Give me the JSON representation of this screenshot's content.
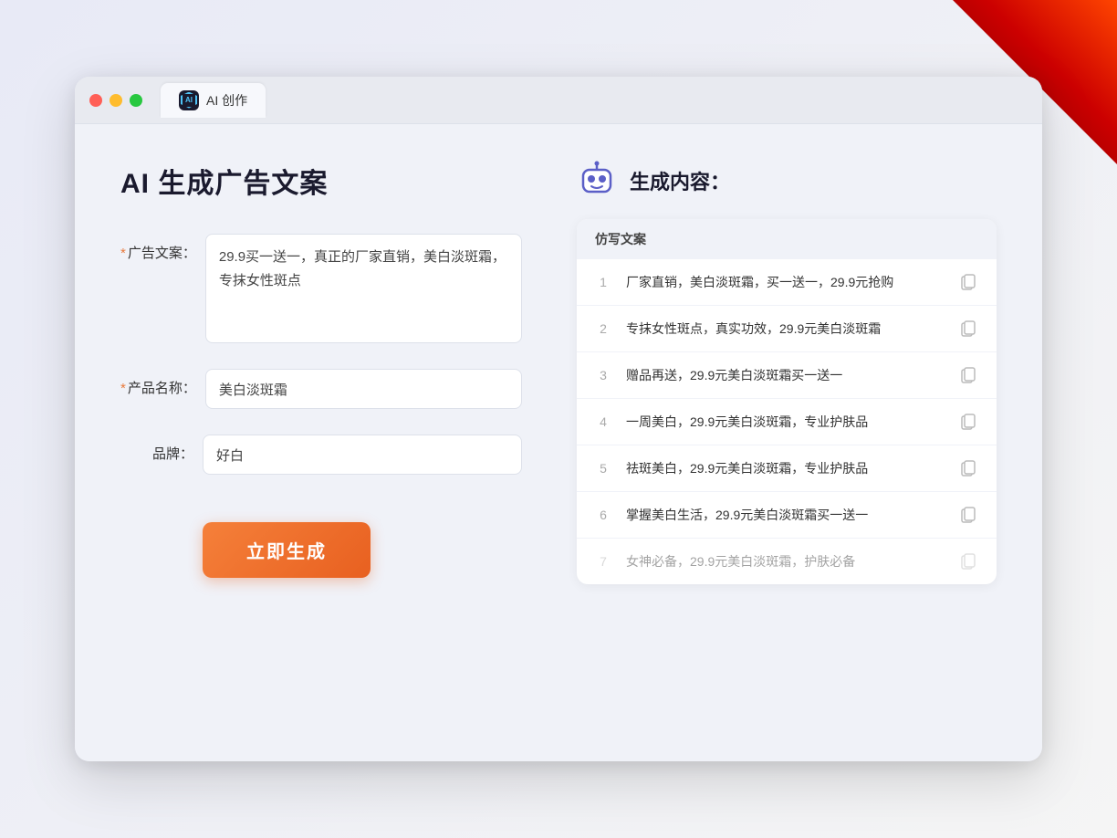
{
  "window": {
    "tab_label": "AI 创作",
    "controls": {
      "close": "close",
      "minimize": "minimize",
      "maximize": "maximize"
    }
  },
  "left_panel": {
    "title": "AI 生成广告文案",
    "form": {
      "ad_copy_label": "广告文案：",
      "ad_copy_required": "*",
      "ad_copy_value": "29.9买一送一，真正的厂家直销，美白淡斑霜，专抹女性斑点",
      "product_name_label": "产品名称：",
      "product_name_required": "*",
      "product_name_value": "美白淡斑霜",
      "brand_label": "品牌：",
      "brand_value": "好白"
    },
    "generate_button": "立即生成"
  },
  "right_panel": {
    "header_title": "生成内容：",
    "table_header": "仿写文案",
    "results": [
      {
        "num": "1",
        "text": "厂家直销，美白淡斑霜，买一送一，29.9元抢购",
        "muted": false
      },
      {
        "num": "2",
        "text": "专抹女性斑点，真实功效，29.9元美白淡斑霜",
        "muted": false
      },
      {
        "num": "3",
        "text": "赠品再送，29.9元美白淡斑霜买一送一",
        "muted": false
      },
      {
        "num": "4",
        "text": "一周美白，29.9元美白淡斑霜，专业护肤品",
        "muted": false
      },
      {
        "num": "5",
        "text": "祛斑美白，29.9元美白淡斑霜，专业护肤品",
        "muted": false
      },
      {
        "num": "6",
        "text": "掌握美白生活，29.9元美白淡斑霜买一送一",
        "muted": false
      },
      {
        "num": "7",
        "text": "女神必备，29.9元美白淡斑霜，护肤必备",
        "muted": true
      }
    ]
  }
}
